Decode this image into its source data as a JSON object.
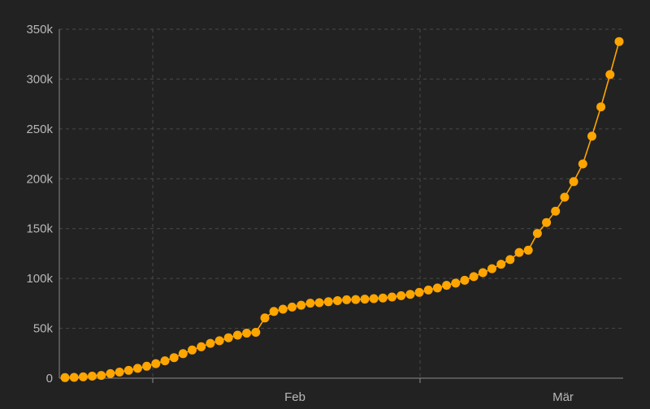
{
  "chart_data": {
    "type": "line",
    "title": "",
    "xlabel": "",
    "ylabel": "",
    "x_tick_labels": [
      "Feb",
      "Mär"
    ],
    "y_tick_labels": [
      "0",
      "50k",
      "100k",
      "150k",
      "200k",
      "250k",
      "300k",
      "350k"
    ],
    "ylim": [
      0,
      350000
    ],
    "grid": true,
    "legend": "none",
    "colors": {
      "background": "#222222",
      "series": "#ffa500",
      "grid": "#4a4a4a",
      "axis": "#8a8a8a",
      "tick_text": "#b8b8b8"
    },
    "series": [
      {
        "values": [
          580,
          845,
          1320,
          2010,
          2800,
          4580,
          6070,
          7820,
          9820,
          11950,
          14550,
          17390,
          20630,
          24550,
          28280,
          31480,
          34880,
          37550,
          40550,
          43100,
          45170,
          46000,
          60400,
          66900,
          69200,
          71300,
          73200,
          75200,
          75700,
          76700,
          77700,
          78600,
          78900,
          79300,
          79800,
          80400,
          81400,
          82700,
          84100,
          86000,
          88400,
          90400,
          93100,
          95300,
          98200,
          101800,
          105800,
          109800,
          114300,
          118900,
          126100,
          128400,
          145200,
          156100,
          167500,
          181500,
          197100,
          214900,
          242700,
          272100,
          304500,
          337600
        ]
      }
    ]
  }
}
